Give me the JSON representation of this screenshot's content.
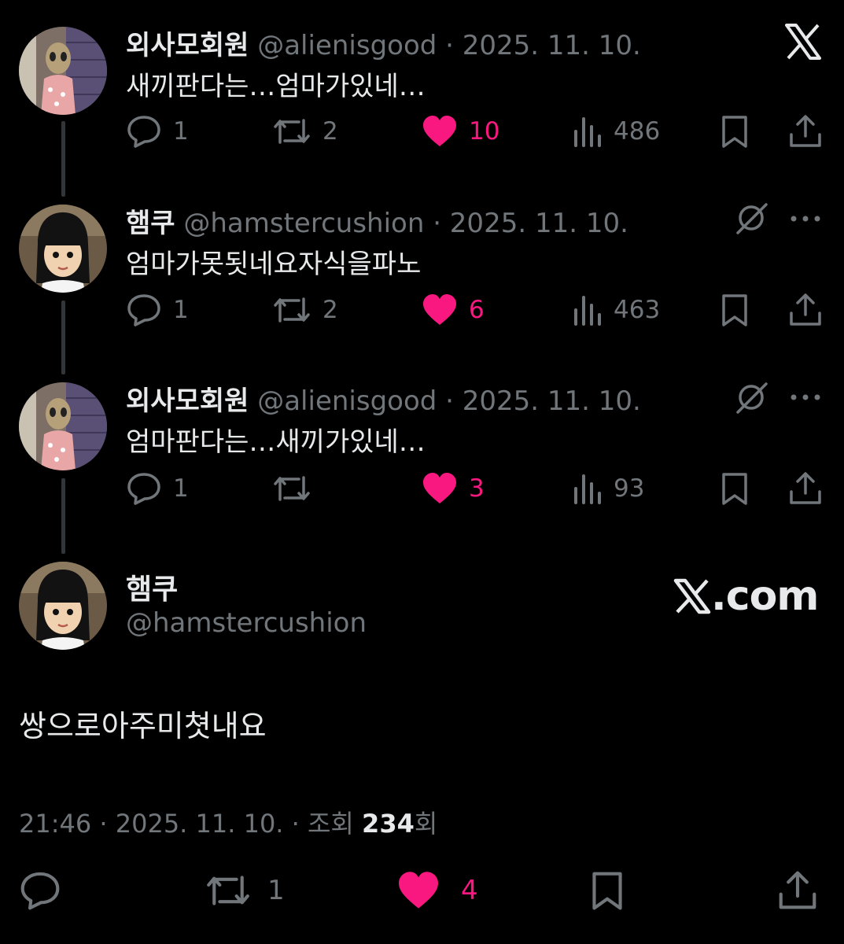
{
  "tweets": [
    {
      "name": "외사모회원",
      "handle": "@alienisgood",
      "date": "· 2025. 11. 10.",
      "text": "새끼판다는…엄마가있네…",
      "avatar": "alien-avatar",
      "corner_icon": "x-logo-icon",
      "stats": {
        "replies": "1",
        "reposts": "2",
        "likes": "10",
        "views": "486"
      }
    },
    {
      "name": "햄쿠",
      "handle": "@hamstercushion",
      "date": "· 2025. 11. 10.",
      "text": "엄마가못됫네요자식을파노",
      "avatar": "mii-avatar",
      "corner_icon": "grok-icon",
      "stats": {
        "replies": "1",
        "reposts": "2",
        "likes": "6",
        "views": "463"
      }
    },
    {
      "name": "외사모회원",
      "handle": "@alienisgood",
      "date": "· 2025. 11. 10.",
      "text": "엄마판다는…새끼가있네…",
      "avatar": "alien-avatar",
      "corner_icon": "grok-icon",
      "stats": {
        "replies": "1",
        "reposts": "",
        "likes": "3",
        "views": "93"
      }
    }
  ],
  "main_tweet": {
    "name": "햄쿠",
    "handle": "@hamstercushion",
    "brand": ".com",
    "text": "쌍으로아주미쳣내요",
    "time": "21:46 · 2025. 11. 10. · 조회 ",
    "views": "234",
    "views_suffix": "회",
    "stats": {
      "replies": "",
      "reposts": "1",
      "likes": "4"
    }
  },
  "colors": {
    "background": "#000000",
    "text": "#e7e9ea",
    "muted": "#71767b",
    "like": "#f91880"
  }
}
